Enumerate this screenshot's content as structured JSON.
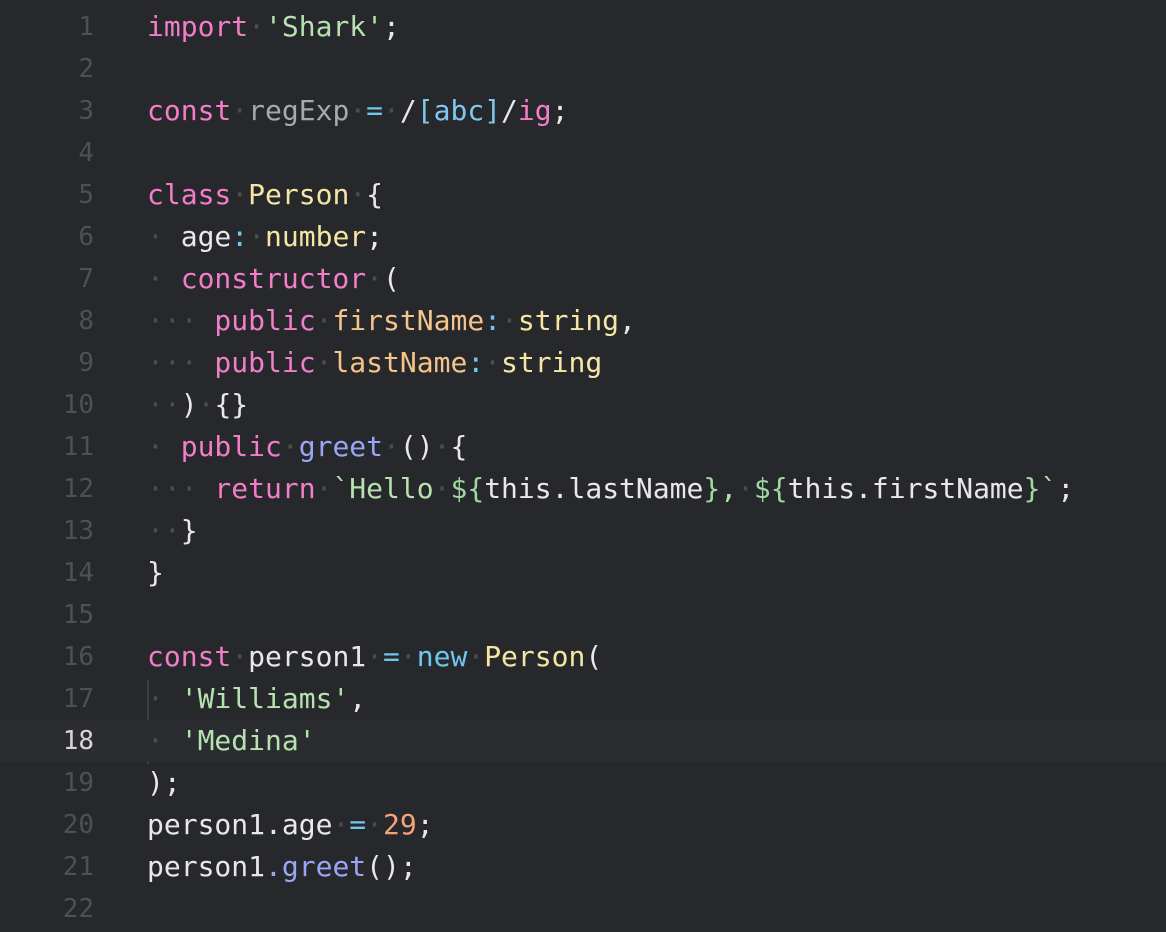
{
  "editor": {
    "active_line": 18,
    "lines": [
      {
        "n": "1",
        "tokens": [
          [
            "kw",
            "import"
          ],
          [
            "ws",
            "·"
          ],
          [
            "str",
            "'Shark'"
          ],
          [
            "punc",
            ";"
          ]
        ]
      },
      {
        "n": "2",
        "tokens": []
      },
      {
        "n": "3",
        "tokens": [
          [
            "kw",
            "const"
          ],
          [
            "ws",
            "·"
          ],
          [
            "dim",
            "regExp"
          ],
          [
            "ws",
            "·"
          ],
          [
            "op",
            "="
          ],
          [
            "ws",
            "·"
          ],
          [
            "punc",
            "/"
          ],
          [
            "re",
            "[abc]"
          ],
          [
            "punc",
            "/"
          ],
          [
            "kw",
            "ig"
          ],
          [
            "punc",
            ";"
          ]
        ]
      },
      {
        "n": "4",
        "tokens": []
      },
      {
        "n": "5",
        "tokens": [
          [
            "kw",
            "class"
          ],
          [
            "ws",
            "·"
          ],
          [
            "type",
            "Person"
          ],
          [
            "ws",
            "·"
          ],
          [
            "punc",
            "{"
          ]
        ]
      },
      {
        "n": "6",
        "tokens": [
          [
            "ws",
            "·"
          ],
          [
            "punc",
            " age"
          ],
          [
            "op",
            ":"
          ],
          [
            "ws",
            "·"
          ],
          [
            "type",
            "number"
          ],
          [
            "punc",
            ";"
          ]
        ]
      },
      {
        "n": "7",
        "tokens": [
          [
            "ws",
            "·"
          ],
          [
            "kw",
            " constructor"
          ],
          [
            "ws",
            "·"
          ],
          [
            "punc",
            "("
          ]
        ]
      },
      {
        "n": "8",
        "tokens": [
          [
            "ws",
            "···"
          ],
          [
            "kw",
            " public"
          ],
          [
            "ws",
            "·"
          ],
          [
            "prop",
            "firstName"
          ],
          [
            "op",
            ":"
          ],
          [
            "ws",
            "·"
          ],
          [
            "type",
            "string"
          ],
          [
            "punc",
            ","
          ]
        ]
      },
      {
        "n": "9",
        "tokens": [
          [
            "ws",
            "···"
          ],
          [
            "kw",
            " public"
          ],
          [
            "ws",
            "·"
          ],
          [
            "prop",
            "lastName"
          ],
          [
            "op",
            ":"
          ],
          [
            "ws",
            "·"
          ],
          [
            "type",
            "string"
          ]
        ]
      },
      {
        "n": "10",
        "tokens": [
          [
            "ws",
            "··"
          ],
          [
            "punc",
            ")"
          ],
          [
            "ws",
            "·"
          ],
          [
            "punc",
            "{}"
          ]
        ]
      },
      {
        "n": "11",
        "tokens": [
          [
            "ws",
            "·"
          ],
          [
            "kw",
            " public"
          ],
          [
            "ws",
            "·"
          ],
          [
            "fn",
            "greet"
          ],
          [
            "ws",
            "·"
          ],
          [
            "punc",
            "()"
          ],
          [
            "ws",
            "·"
          ],
          [
            "punc",
            "{"
          ]
        ]
      },
      {
        "n": "12",
        "tokens": [
          [
            "ws",
            "···"
          ],
          [
            "kw",
            " return"
          ],
          [
            "ws",
            "·"
          ],
          [
            "str",
            "`Hello"
          ],
          [
            "ws",
            "·"
          ],
          [
            "tpl",
            "${"
          ],
          [
            "punc",
            "this.lastName"
          ],
          [
            "tpl",
            "}"
          ],
          [
            "str",
            ","
          ],
          [
            "ws",
            "·"
          ],
          [
            "tpl",
            "${"
          ],
          [
            "punc",
            "this.firstName"
          ],
          [
            "tpl",
            "}"
          ],
          [
            "str",
            "`"
          ],
          [
            "punc",
            ";"
          ]
        ]
      },
      {
        "n": "13",
        "tokens": [
          [
            "ws",
            "··"
          ],
          [
            "punc",
            "}"
          ]
        ]
      },
      {
        "n": "14",
        "tokens": [
          [
            "punc",
            "}"
          ]
        ]
      },
      {
        "n": "15",
        "tokens": []
      },
      {
        "n": "16",
        "tokens": [
          [
            "kw",
            "const"
          ],
          [
            "ws",
            "·"
          ],
          [
            "punc",
            "person1"
          ],
          [
            "ws",
            "·"
          ],
          [
            "op",
            "="
          ],
          [
            "ws",
            "·"
          ],
          [
            "op",
            "new"
          ],
          [
            "ws",
            "·"
          ],
          [
            "type",
            "Person"
          ],
          [
            "punc",
            "("
          ]
        ]
      },
      {
        "n": "17",
        "tokens": [
          [
            "ws",
            "·"
          ],
          [
            "str",
            " 'Williams'"
          ],
          [
            "punc",
            ","
          ]
        ]
      },
      {
        "n": "18",
        "tokens": [
          [
            "ws",
            "·"
          ],
          [
            "str",
            " 'Medina'"
          ]
        ]
      },
      {
        "n": "19",
        "tokens": [
          [
            "punc",
            ");"
          ]
        ]
      },
      {
        "n": "20",
        "tokens": [
          [
            "punc",
            "person1.age"
          ],
          [
            "ws",
            "·"
          ],
          [
            "op",
            "="
          ],
          [
            "ws",
            "·"
          ],
          [
            "num",
            "29"
          ],
          [
            "punc",
            ";"
          ]
        ]
      },
      {
        "n": "21",
        "tokens": [
          [
            "punc",
            "person1"
          ],
          [
            "fn",
            ".greet"
          ],
          [
            "punc",
            "();"
          ]
        ]
      },
      {
        "n": "22",
        "tokens": []
      }
    ]
  },
  "colors": {
    "background": "#26282b",
    "keyword": "#f27dc8",
    "string": "#b6e2b1",
    "type": "#f5e6a3",
    "property": "#f5c48a",
    "operator": "#6fc7ee",
    "function": "#9aa6f5",
    "number": "#f5a27a",
    "line_number": "#4d5157"
  }
}
